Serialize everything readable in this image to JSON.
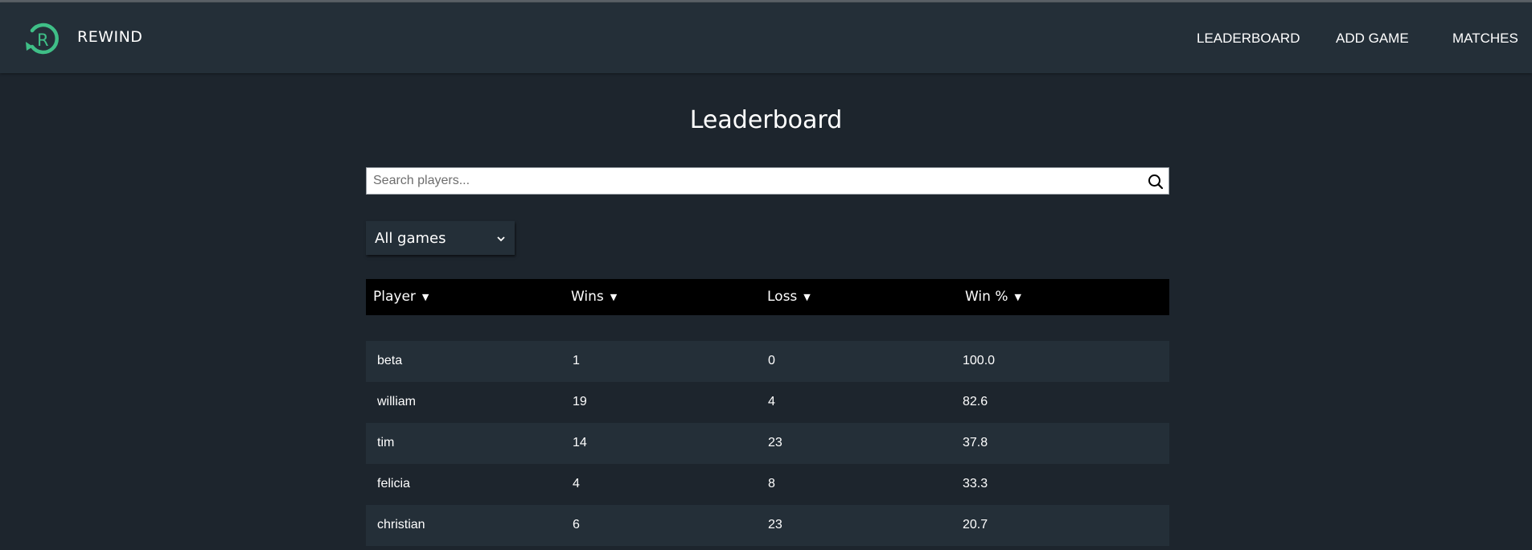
{
  "app": {
    "brand": "REWIND",
    "accent_color": "#3fbf87",
    "logo_letter": "R"
  },
  "nav": {
    "leaderboard": "LEADERBOARD",
    "add_game": "ADD GAME",
    "matches": "MATCHES"
  },
  "page": {
    "title": "Leaderboard"
  },
  "search": {
    "placeholder": "Search players...",
    "value": ""
  },
  "filter": {
    "selected": "All games"
  },
  "table": {
    "columns": [
      "Player",
      "Wins",
      "Loss",
      "Win %"
    ],
    "sort_indicator": "▼",
    "rows": [
      {
        "player": "beta",
        "wins": "1",
        "loss": "0",
        "win_pct": "100.0"
      },
      {
        "player": "william",
        "wins": "19",
        "loss": "4",
        "win_pct": "82.6"
      },
      {
        "player": "tim",
        "wins": "14",
        "loss": "23",
        "win_pct": "37.8"
      },
      {
        "player": "felicia",
        "wins": "4",
        "loss": "8",
        "win_pct": "33.3"
      },
      {
        "player": "christian",
        "wins": "6",
        "loss": "23",
        "win_pct": "20.7"
      }
    ]
  }
}
